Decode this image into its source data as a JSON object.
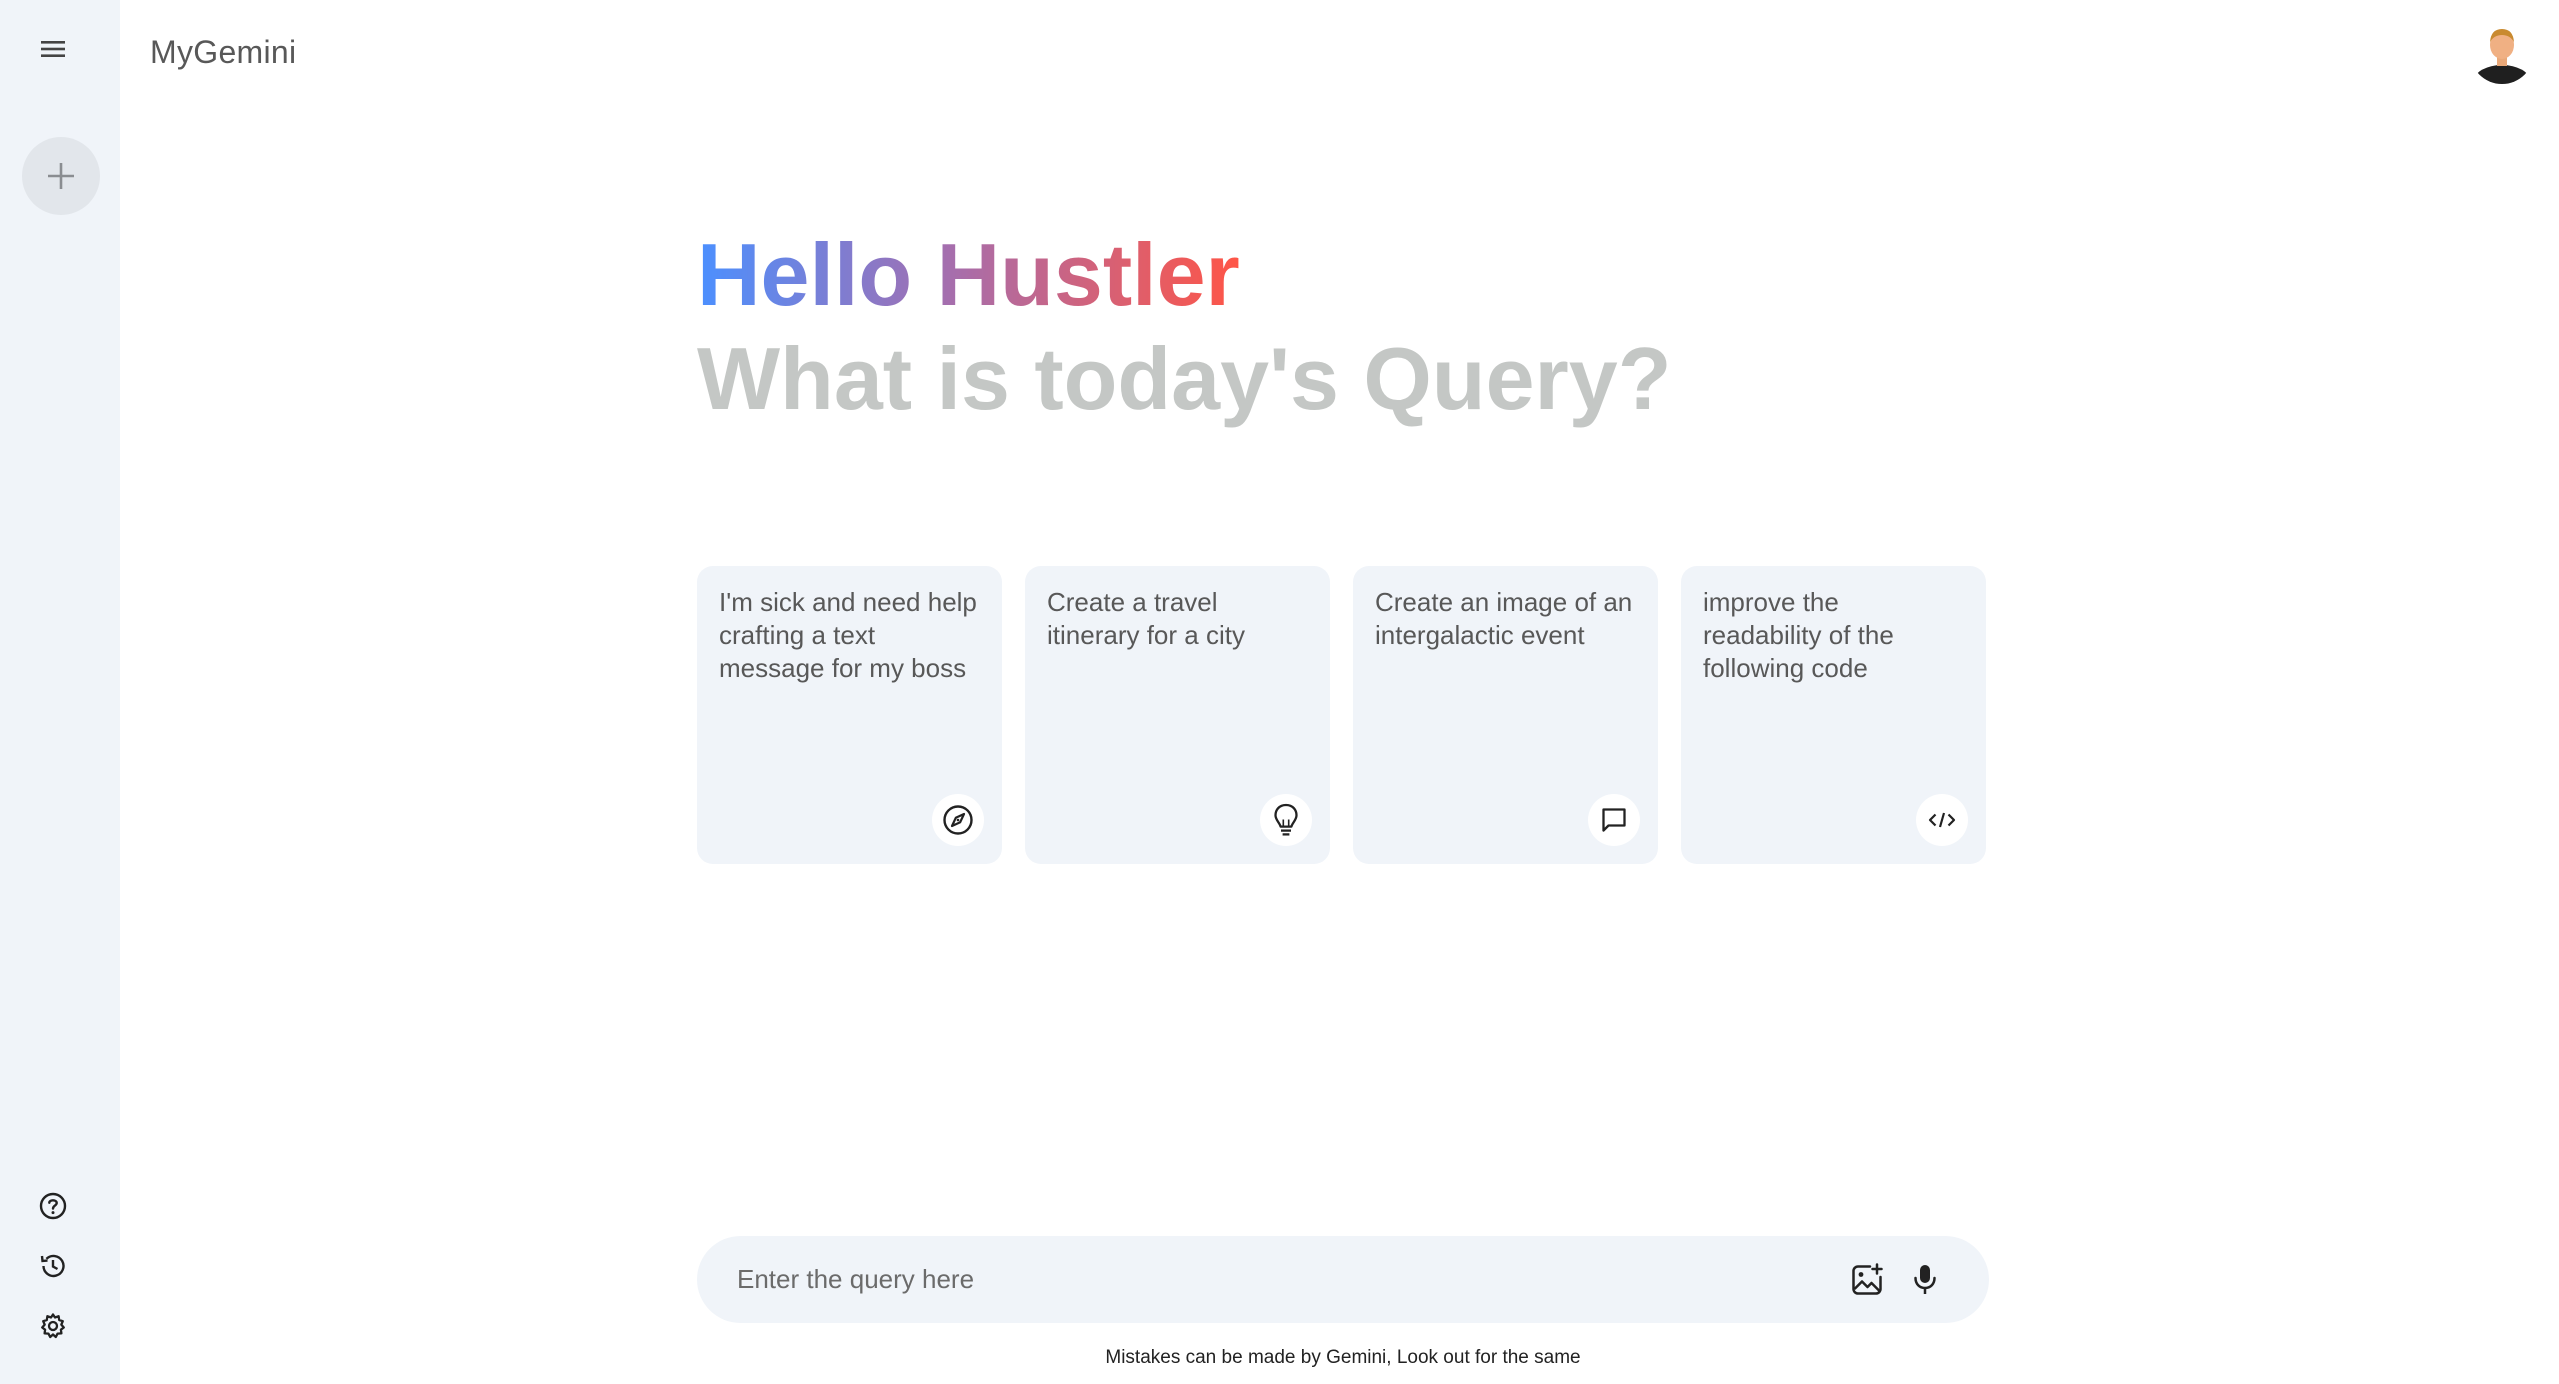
{
  "app": {
    "brand": "MyGemini"
  },
  "sidebar": {
    "menu_icon": "menu-icon",
    "new_chat_icon": "plus-icon",
    "bottom_icons": [
      "help-icon",
      "history-icon",
      "settings-icon"
    ]
  },
  "greeting": {
    "hello": "Hello Hustler",
    "question": "What is today's Query?"
  },
  "cards": [
    {
      "text": "I'm sick and need help crafting a text message for my boss",
      "icon": "compass-icon"
    },
    {
      "text": "Create a travel itinerary for a city",
      "icon": "bulb-icon"
    },
    {
      "text": "Create an image of an intergalactic event",
      "icon": "message-icon"
    },
    {
      "text": "improve the readability of the following code",
      "icon": "code-icon"
    }
  ],
  "search": {
    "placeholder": "Enter the query here",
    "value": ""
  },
  "footer": {
    "disclaimer": "Mistakes can be made by Gemini, Look out for the same"
  },
  "colors": {
    "sidebar_bg": "#f0f4f9",
    "card_bg": "#f0f4f9",
    "gradient_start": "#4b90ff",
    "gradient_end": "#ff5546",
    "muted_heading": "#c4c7c5"
  }
}
